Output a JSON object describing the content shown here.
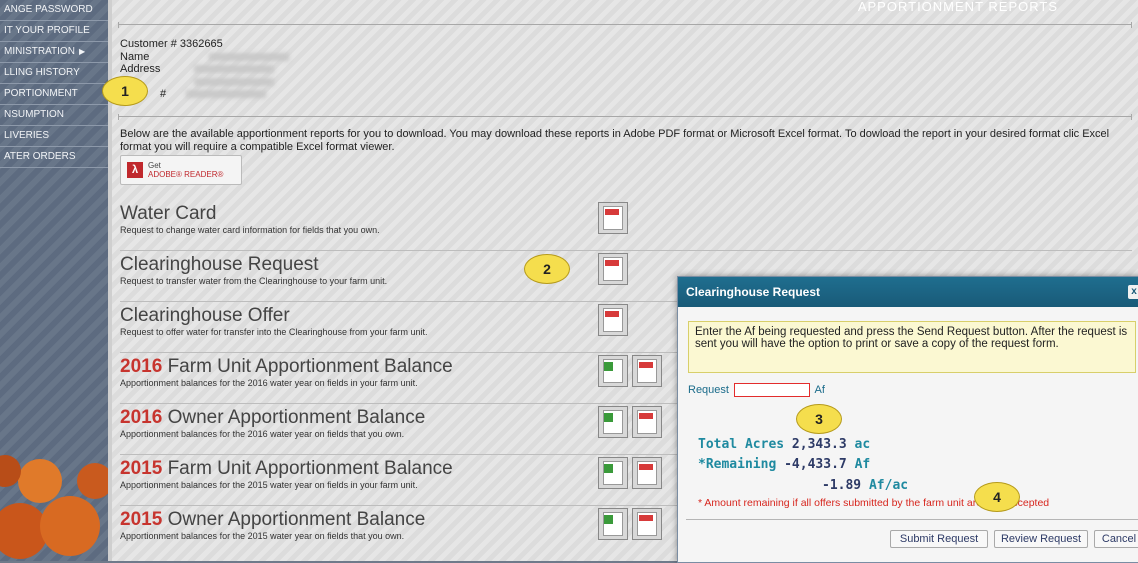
{
  "sidebar": {
    "items": [
      {
        "label": "ANGE PASSWORD"
      },
      {
        "label": "IT YOUR PROFILE"
      },
      {
        "label": "MINISTRATION"
      },
      {
        "label": "LLING HISTORY"
      },
      {
        "label": "PORTIONMENT"
      },
      {
        "label": "NSUMPTION"
      },
      {
        "label": "LIVERIES"
      },
      {
        "label": "ATER ORDERS"
      }
    ]
  },
  "header": {
    "title": "APPORTIONMENT REPORTS"
  },
  "customer": {
    "number_line": "Customer # 3362665",
    "name_label": "Name",
    "address_label": "Address",
    "phone_label": "#"
  },
  "intro": {
    "text": "Below are the available apportionment reports for you to download. You may download these reports in Adobe PDF format or Microsoft Excel format. To dowload the report in your desired format clic Excel format you will require a compatible Excel format viewer."
  },
  "adobe": {
    "get": "Get",
    "reader": "ADOBE® READER®"
  },
  "reports": [
    {
      "year": "",
      "title": "Water Card",
      "desc": "Request to change water card information for fields that you own."
    },
    {
      "year": "",
      "title": "Clearinghouse Request",
      "desc": "Request to transfer water from the Clearinghouse to your farm unit."
    },
    {
      "year": "",
      "title": "Clearinghouse Offer",
      "desc": "Request to offer water for transfer into the Clearinghouse from your farm unit."
    },
    {
      "year": "2016",
      "title": "Farm Unit Apportionment Balance",
      "desc": "Apportionment balances for the 2016 water year on fields in your farm unit."
    },
    {
      "year": "2016",
      "title": "Owner Apportionment Balance",
      "desc": "Apportionment balances for the 2016 water year on fields that you own."
    },
    {
      "year": "2015",
      "title": "Farm Unit Apportionment Balance",
      "desc": "Apportionment balances for the 2015 water year on fields in your farm unit."
    },
    {
      "year": "2015",
      "title": "Owner Apportionment Balance",
      "desc": "Apportionment balances for the 2015 water year on fields that you own."
    }
  ],
  "dialog": {
    "title": "Clearinghouse Request",
    "close": "x",
    "info": "Enter the Af being requested and press the Send Request button. After the request is sent you will have the option to print or save a copy of the request form.",
    "request_label": "Request",
    "request_unit": "Af",
    "request_value": "",
    "total_acres_label": "Total Acres",
    "total_acres_value": "2,343.3",
    "total_acres_unit": "ac",
    "remaining_label": "*Remaining",
    "remaining_value": "-4,433.7",
    "remaining_unit": "Af",
    "per_acre_value": "-1.89",
    "per_acre_unit": "Af/ac",
    "note": "* Amount remaining if all offers submitted by the farm unit are fully accepted",
    "buttons": {
      "submit": "Submit Request",
      "review": "Review Request",
      "cancel": "Cancel"
    }
  },
  "callouts": [
    "1",
    "2",
    "3",
    "4"
  ]
}
